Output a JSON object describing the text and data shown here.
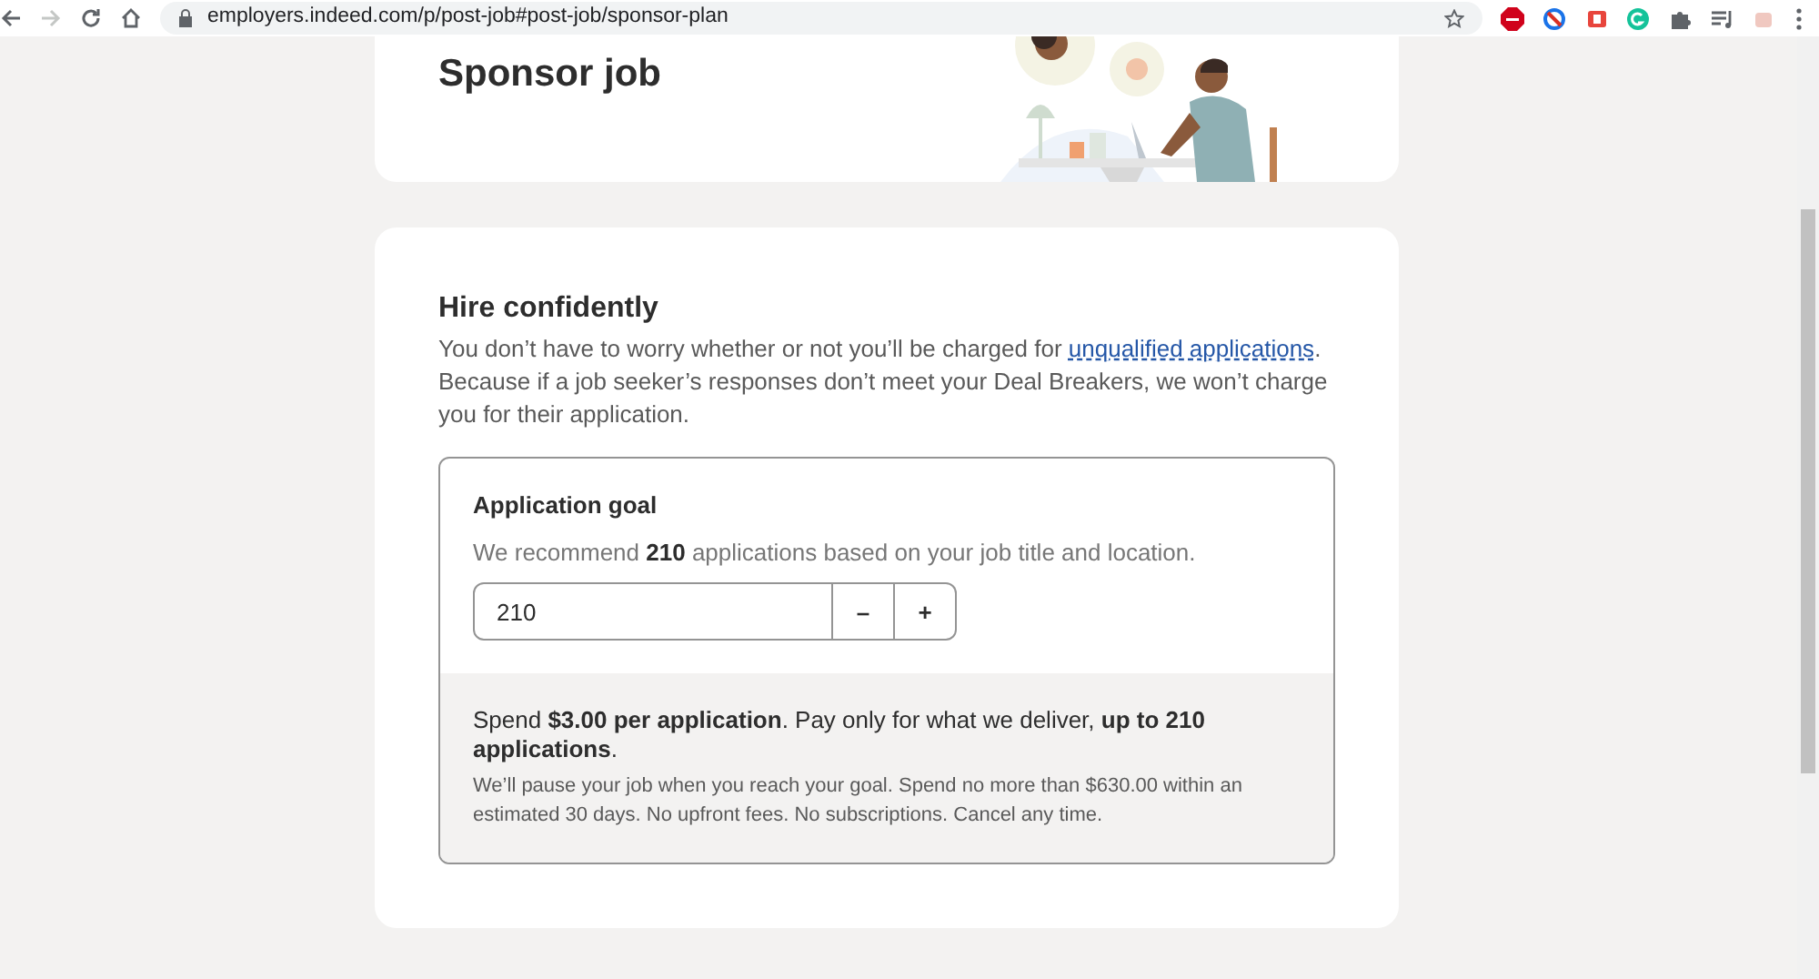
{
  "browser": {
    "url": "employers.indeed.com/p/post-job#post-job/sponsor-plan",
    "forward_enabled": false
  },
  "header_card": {
    "title": "Sponsor job"
  },
  "hire_card": {
    "title": "Hire confidently",
    "intro_before": "You don’t have to worry whether or not you’ll be charged for ",
    "intro_link": "unqualified applications",
    "intro_after": ". Because if a job seeker’s responses don’t meet your Deal Breakers, we won’t charge you for their application.",
    "goal": {
      "title": "Application goal",
      "recommendation": "We recommend **210** applications based on your job title and location.",
      "value": "210",
      "decrement": "–",
      "increment": "+",
      "summary": "Spend **$3.00 per application**. Pay only for what we deliver, **up to 210 applications**.",
      "details": "We’ll pause your job when you reach your goal. Spend no more than $630.00 within an estimated 30 days. No upfront fees. No subscriptions. Cancel any time."
    }
  }
}
